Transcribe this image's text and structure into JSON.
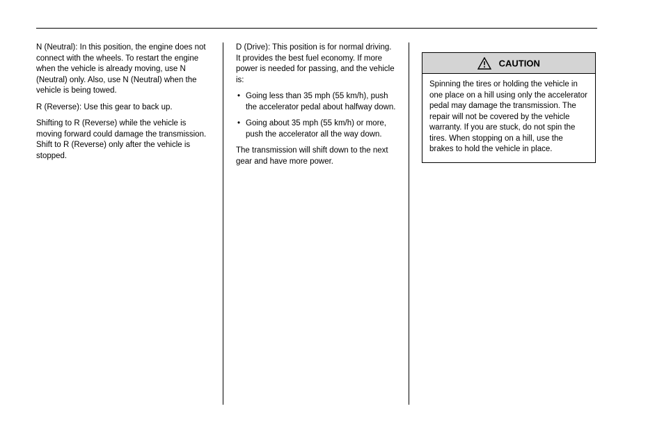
{
  "header_rule": true,
  "columns": {
    "col1": {
      "paragraphs": [
        "N (Neutral): In this position, the engine does not connect with the wheels. To restart the engine when the vehicle is already moving, use N (Neutral) only. Also, use N (Neutral) when the vehicle is being towed.",
        "R (Reverse): Use this gear to back up.",
        "Shifting to R (Reverse) while the vehicle is moving forward could damage the transmission. Shift to R (Reverse) only after the vehicle is stopped."
      ],
      "bullets": []
    },
    "col2": {
      "paragraphs": [
        "D (Drive): This position is for normal driving. It provides the best fuel economy. If more power is needed for passing, and the vehicle is:"
      ],
      "bullets": [
        "Going less than 35 mph (55 km/h), push the accelerator pedal about halfway down.",
        "Going about 35 mph (55 km/h) or more, push the accelerator all the way down."
      ],
      "paragraphs_after": [
        "The transmission will shift down to the next gear and have more power."
      ]
    },
    "col3": {
      "caution": {
        "label": "CAUTION",
        "body": [
          "Spinning the tires or holding the vehicle in one place on a hill using only the accelerator pedal may damage the transmission. The repair will not be covered by the vehicle warranty. If you are stuck, do not spin the tires. When stopping on a hill, use the brakes to hold the vehicle in place."
        ]
      },
      "paragraphs_after": []
    }
  }
}
